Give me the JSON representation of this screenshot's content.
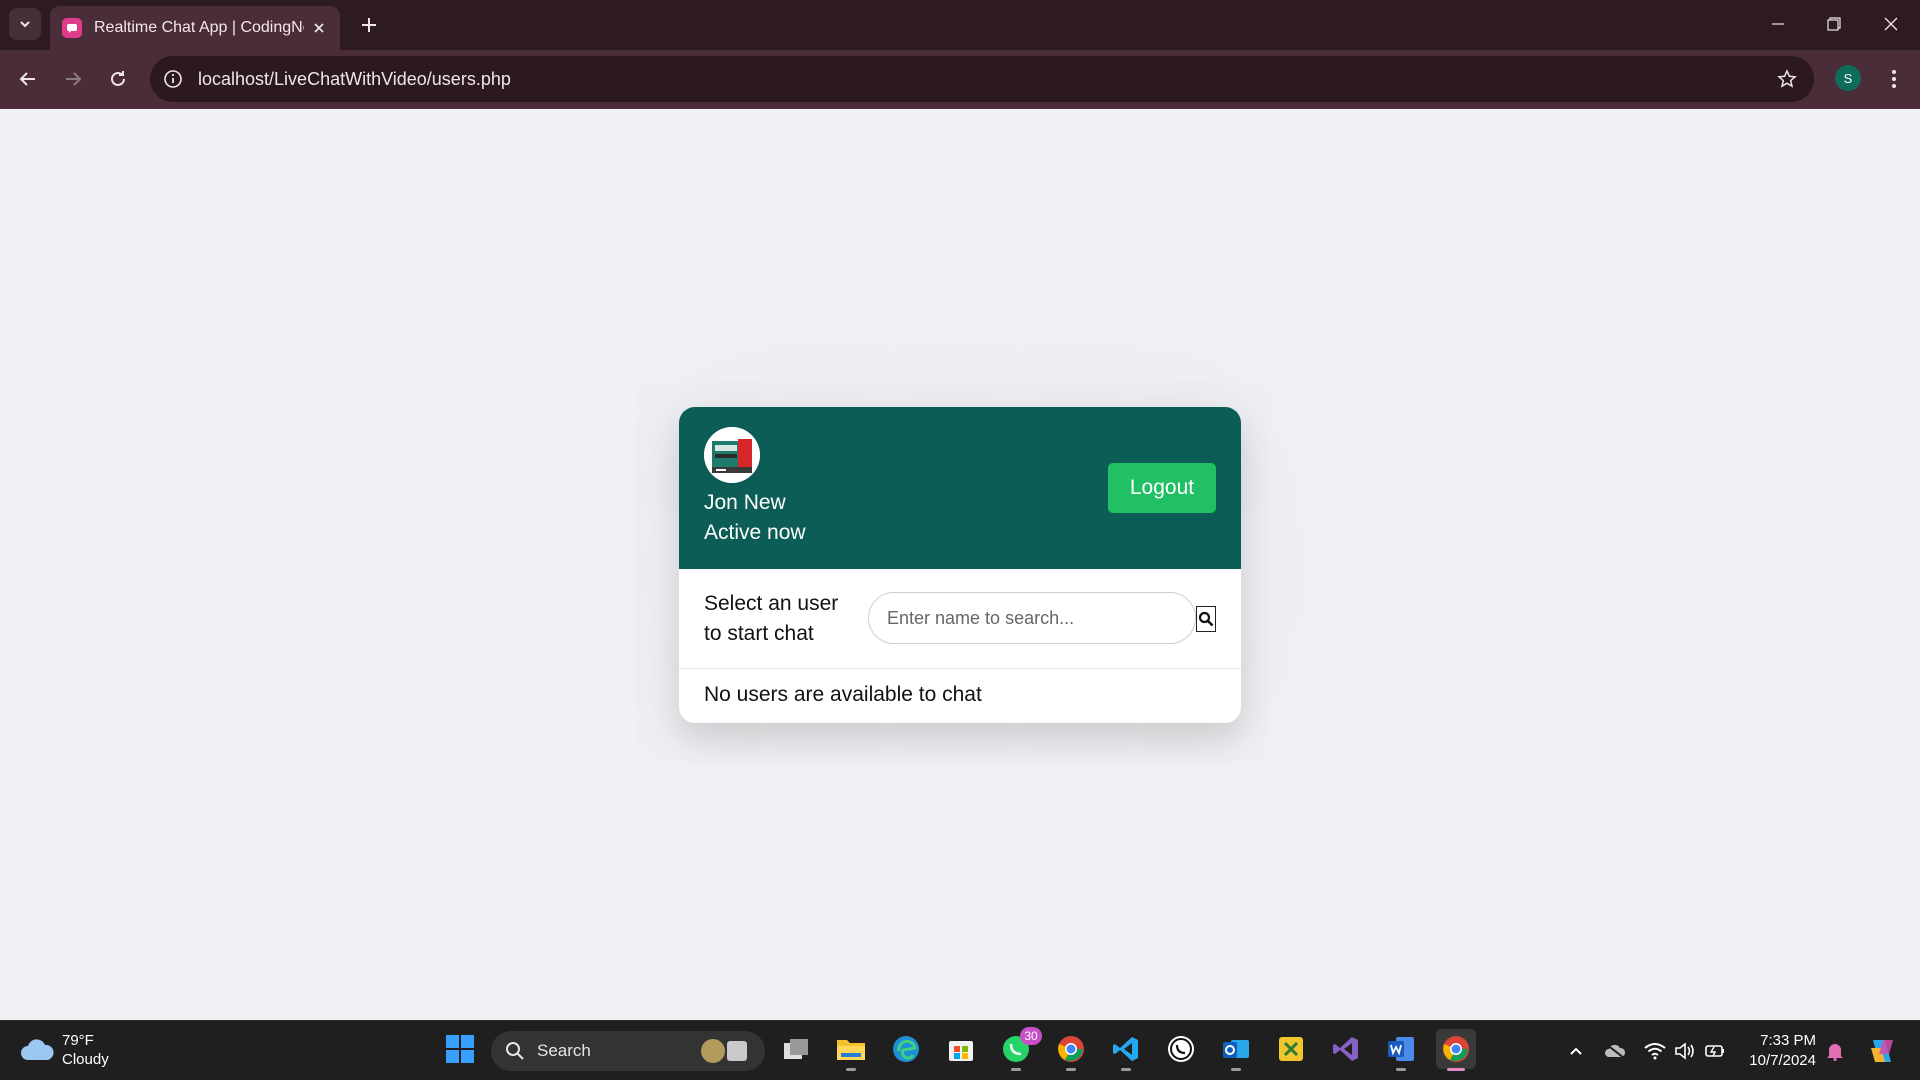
{
  "browser": {
    "tab_title": "Realtime Chat App | CodingNepal",
    "url": "localhost/LiveChatWithVideo/users.php",
    "profile_initial": "S"
  },
  "header": {
    "user_name": "Jon New",
    "status": "Active now",
    "logout_label": "Logout"
  },
  "search": {
    "label": "Select an user to start chat",
    "placeholder": "Enter name to search..."
  },
  "users": {
    "empty_message": "No users are available to chat"
  },
  "taskbar": {
    "weather_temp": "79°F",
    "weather_desc": "Cloudy",
    "search_label": "Search",
    "whatsapp_badge": "30",
    "time": "7:33 PM",
    "date": "10/7/2024"
  },
  "colors": {
    "header_bg": "#0c5d55",
    "logout_bg": "#21c064",
    "page_bg": "#f0f1f4",
    "browser_frame": "#4a2d38"
  }
}
